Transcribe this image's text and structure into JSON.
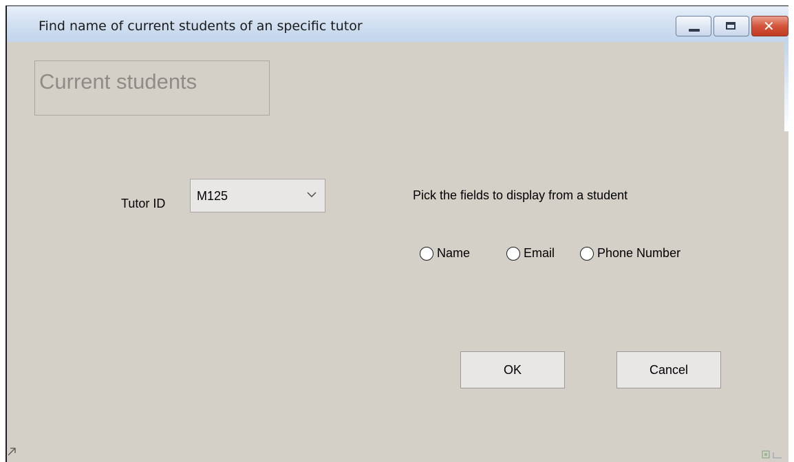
{
  "window": {
    "title": "Find name of current students of an specific tutor",
    "controls": {
      "minimize": "minimize-icon",
      "maximize": "maximize-icon",
      "close_glyph": "✕"
    }
  },
  "header": {
    "label": "Current students"
  },
  "tutor": {
    "label": "Tutor ID",
    "selected": "M125",
    "icon": "chevron-down-icon"
  },
  "fields": {
    "prompt": "Pick the fields to display from a student",
    "options": [
      "Name",
      "Email",
      "Phone Number"
    ]
  },
  "buttons": {
    "ok": "OK",
    "cancel": "Cancel"
  },
  "colors": {
    "window_bg": "#d4d0c8",
    "titlebar": "#c2d5ec",
    "close_button": "#c13b22",
    "header_text": "#8e8c87"
  }
}
